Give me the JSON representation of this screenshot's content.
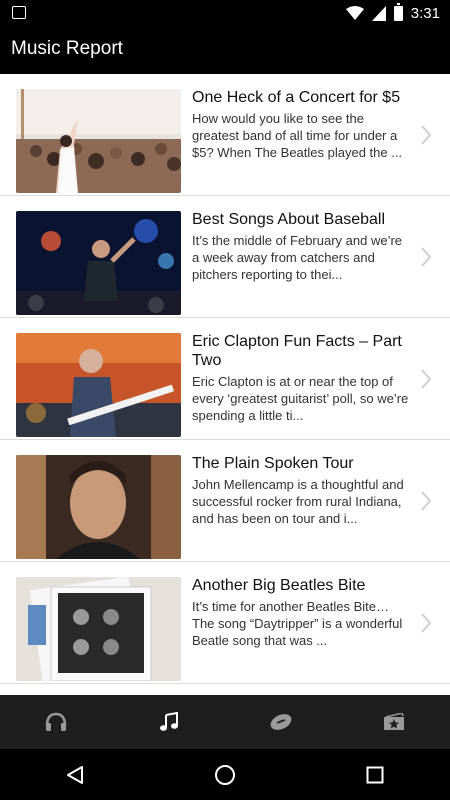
{
  "status_bar": {
    "time": "3:31"
  },
  "app": {
    "title": "Music Report"
  },
  "articles": [
    {
      "title": "One Heck of a Concert for $5",
      "snippet": "How would you like to see the greatest band of all time for under a $5? When The Beatles played the ..."
    },
    {
      "title": "Best Songs About Baseball",
      "snippet": "It’s the middle of February and we’re a week away from catchers and pitchers reporting to thei..."
    },
    {
      "title": "Eric Clapton Fun Facts – Part Two",
      "snippet": "Eric Clapton is at or near the top of every ‘greatest guitarist’ poll, so we’re spending a little ti..."
    },
    {
      "title": "The Plain Spoken Tour",
      "snippet": "John Mellencamp is a thoughtful and successful rocker from rural Indiana, and has been on tour and i..."
    },
    {
      "title": "Another Big Beatles Bite",
      "snippet": "It’s time for another Beatles Bite… The song “Daytripper” is a wonderful Beatle song that was ..."
    }
  ],
  "bottom_nav": [
    {
      "icon": "headphones-icon",
      "active": false
    },
    {
      "icon": "music-note-icon",
      "active": true
    },
    {
      "icon": "football-icon",
      "active": false
    },
    {
      "icon": "ticket-star-icon",
      "active": false
    }
  ],
  "colors": {
    "app_bar": "#000000",
    "bottom_nav": "#1e1e1e",
    "list_bg": "#ffffff",
    "active_icon": "#ffffff",
    "inactive_icon": "#9a9a9a"
  }
}
